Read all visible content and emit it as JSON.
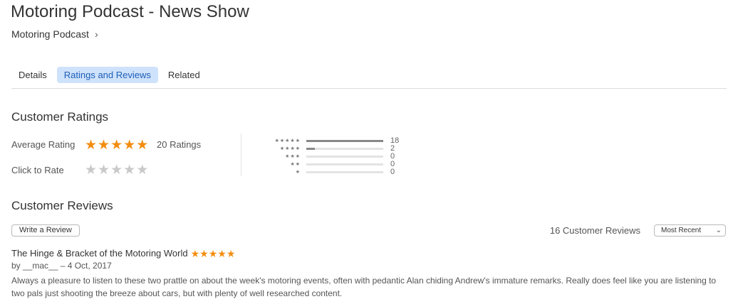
{
  "header": {
    "title": "Motoring Podcast - News Show",
    "subtitle": "Motoring Podcast",
    "subtitle_chevron": "›"
  },
  "tabs": [
    {
      "label": "Details",
      "active": false
    },
    {
      "label": "Ratings and Reviews",
      "active": true
    },
    {
      "label": "Related",
      "active": false
    }
  ],
  "ratings": {
    "section_title": "Customer Ratings",
    "average_label": "Average Rating",
    "average_stars": 5,
    "ratings_count": "20 Ratings",
    "click_to_rate_label": "Click to Rate",
    "histogram": [
      {
        "stars": "★★★★★",
        "count": "18",
        "fraction": 1.0
      },
      {
        "stars": "★★★★",
        "count": "2",
        "fraction": 0.11
      },
      {
        "stars": "★★★",
        "count": "0",
        "fraction": 0
      },
      {
        "stars": "★★",
        "count": "0",
        "fraction": 0
      },
      {
        "stars": "★",
        "count": "0",
        "fraction": 0
      }
    ]
  },
  "reviews": {
    "section_title": "Customer Reviews",
    "write_button": "Write a Review",
    "count_label": "16 Customer Reviews",
    "sort_value": "Most Recent",
    "items": [
      {
        "title": "The Hinge & Bracket of the Motoring World",
        "stars": 5,
        "meta": "by __mac__ – 4 Oct, 2017",
        "body": "Always a pleasure to listen to these two prattle on about the week's motoring events, often with pedantic Alan chiding Andrew's immature remarks. Really does feel like you are listening to two pals just shooting the breeze about cars, but with plenty of well researched content."
      }
    ]
  },
  "colors": {
    "accent_tab_bg": "#cfe2fb",
    "accent_tab_text": "#1d5fb8",
    "star_filled": "#f38d10",
    "star_empty": "#c9c9c9"
  }
}
